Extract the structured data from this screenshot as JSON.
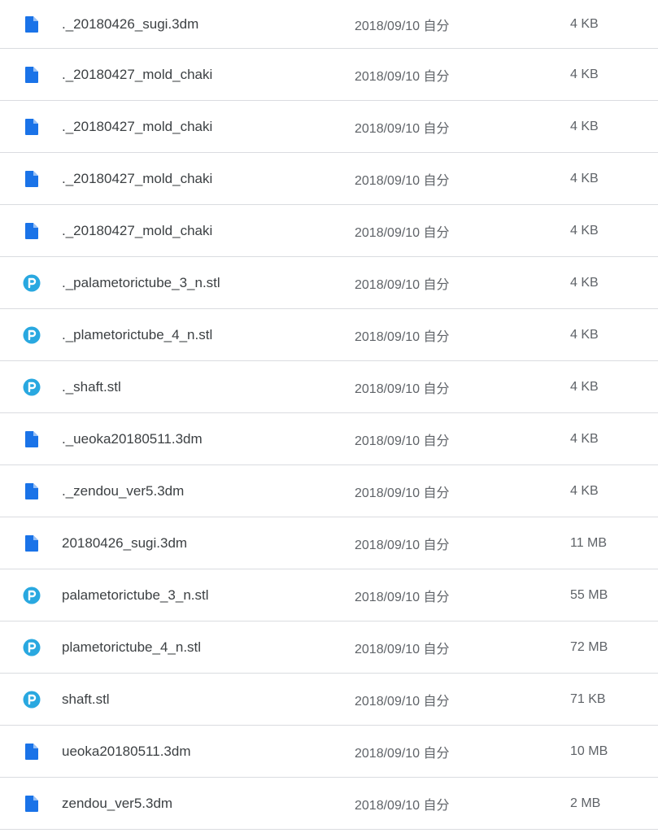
{
  "colors": {
    "doc_icon": "#1a73e8",
    "stl_icon": "#29a8e0",
    "divider": "#dadce0",
    "name_text": "#3c4043",
    "meta_text": "#5f6368"
  },
  "files": [
    {
      "icon": "document-icon",
      "name": "._20180426_sugi.3dm",
      "modified": "2018/09/10 自分",
      "size": "4 KB"
    },
    {
      "icon": "document-icon",
      "name": "._20180427_mold_chaki",
      "modified": "2018/09/10 自分",
      "size": "4 KB"
    },
    {
      "icon": "document-icon",
      "name": "._20180427_mold_chaki",
      "modified": "2018/09/10 自分",
      "size": "4 KB"
    },
    {
      "icon": "document-icon",
      "name": "._20180427_mold_chaki",
      "modified": "2018/09/10 自分",
      "size": "4 KB"
    },
    {
      "icon": "document-icon",
      "name": "._20180427_mold_chaki",
      "modified": "2018/09/10 自分",
      "size": "4 KB"
    },
    {
      "icon": "stl-file-icon",
      "name": "._palametorictube_3_n.stl",
      "modified": "2018/09/10 自分",
      "size": "4 KB"
    },
    {
      "icon": "stl-file-icon",
      "name": "._plametorictube_4_n.stl",
      "modified": "2018/09/10 自分",
      "size": "4 KB"
    },
    {
      "icon": "stl-file-icon",
      "name": "._shaft.stl",
      "modified": "2018/09/10 自分",
      "size": "4 KB"
    },
    {
      "icon": "document-icon",
      "name": "._ueoka20180511.3dm",
      "modified": "2018/09/10 自分",
      "size": "4 KB"
    },
    {
      "icon": "document-icon",
      "name": "._zendou_ver5.3dm",
      "modified": "2018/09/10 自分",
      "size": "4 KB"
    },
    {
      "icon": "document-icon",
      "name": "20180426_sugi.3dm",
      "modified": "2018/09/10 自分",
      "size": "11 MB"
    },
    {
      "icon": "stl-file-icon",
      "name": "palametorictube_3_n.stl",
      "modified": "2018/09/10 自分",
      "size": "55 MB"
    },
    {
      "icon": "stl-file-icon",
      "name": "plametorictube_4_n.stl",
      "modified": "2018/09/10 自分",
      "size": "72 MB"
    },
    {
      "icon": "stl-file-icon",
      "name": "shaft.stl",
      "modified": "2018/09/10 自分",
      "size": "71 KB"
    },
    {
      "icon": "document-icon",
      "name": "ueoka20180511.3dm",
      "modified": "2018/09/10 自分",
      "size": "10 MB"
    },
    {
      "icon": "document-icon",
      "name": "zendou_ver5.3dm",
      "modified": "2018/09/10 自分",
      "size": "2 MB"
    }
  ]
}
